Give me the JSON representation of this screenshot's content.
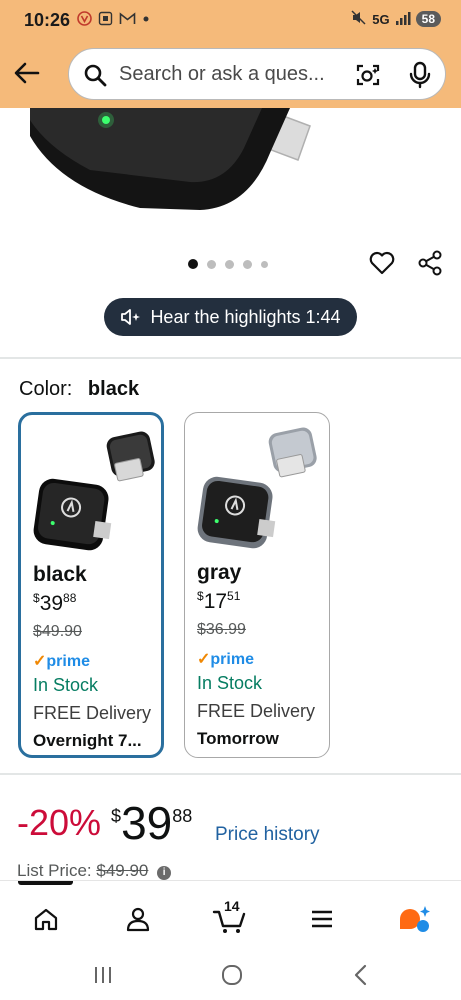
{
  "status_bar": {
    "time": "10:26",
    "left_icons": [
      "vpn-icon",
      "screenshot-icon",
      "gmail-icon",
      "dot-icon"
    ],
    "network": "5G",
    "battery": "58"
  },
  "search": {
    "placeholder": "Search or ask a ques..."
  },
  "gallery": {
    "dot_count": 5,
    "active_index": 0
  },
  "highlights": {
    "label": "Hear the highlights 1:44"
  },
  "color_selector": {
    "label": "Color:",
    "selected": "black"
  },
  "variants": [
    {
      "name": "black",
      "price_symbol": "$",
      "price_whole": "39",
      "price_fraction": "88",
      "list_price": "$49.90",
      "prime_check": "✓",
      "prime_label": "prime",
      "stock": "In Stock",
      "delivery": "FREE Delivery",
      "when": "Overnight 7..."
    },
    {
      "name": "gray",
      "price_symbol": "$",
      "price_whole": "17",
      "price_fraction": "51",
      "list_price": "$36.99",
      "prime_check": "✓",
      "prime_label": "prime",
      "stock": "In Stock",
      "delivery": "FREE Delivery",
      "when": "Tomorrow"
    }
  ],
  "pricing": {
    "discount": "-20%",
    "currency": "$",
    "whole": "39",
    "fraction": "88",
    "price_history": "Price history",
    "list_price_label": "List Price:",
    "list_price_value": "$49.90",
    "info_glyph": "i"
  },
  "bottom_nav": {
    "cart_count": "14",
    "items": [
      "home-icon",
      "account-icon",
      "cart-icon",
      "menu-icon",
      "rufus-icon"
    ]
  },
  "colors": {
    "header_bg": "#f5ba7a",
    "selected_border": "#2a6f9e",
    "discount_red": "#cc0c39",
    "stock_green": "#067d62",
    "link_blue": "#2162a1",
    "prime_blue": "#1f8ce6"
  }
}
